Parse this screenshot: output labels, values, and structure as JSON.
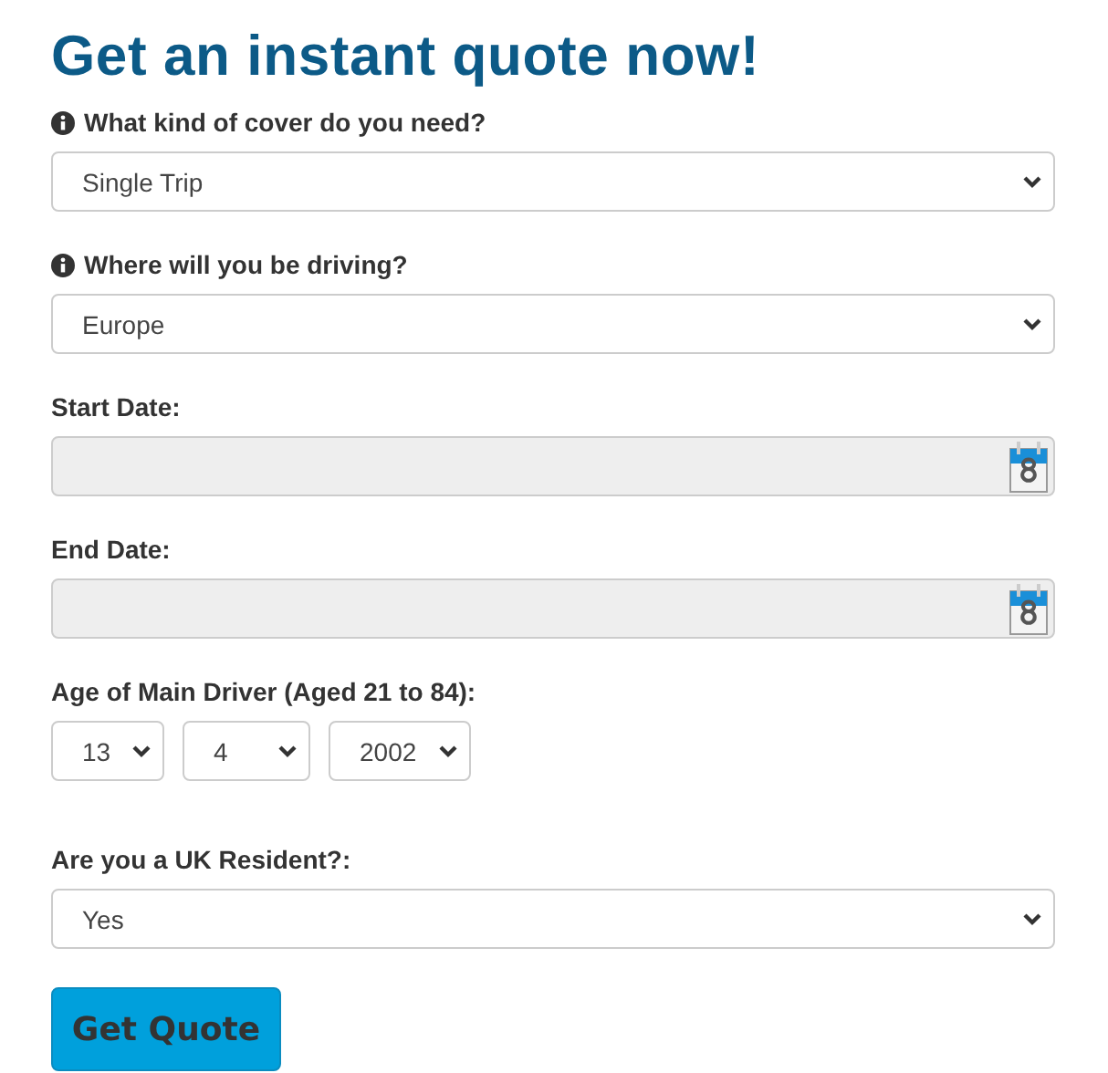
{
  "title": "Get an instant quote now!",
  "fields": [
    {
      "kind": "select",
      "label": "What kind of cover do you need?",
      "info": true,
      "value": "Single Trip"
    },
    {
      "kind": "select",
      "label": "Where will you be driving?",
      "info": true,
      "value": "Europe"
    },
    {
      "kind": "date",
      "label": "Start Date:",
      "info": false,
      "disabled": true
    },
    {
      "kind": "date",
      "label": "End Date:",
      "info": false,
      "disabled": true
    },
    {
      "kind": "dob",
      "label": "Age of Main Driver (Aged 21 to 84):",
      "info": false,
      "parts": [
        "13",
        "4",
        "2002"
      ]
    },
    {
      "kind": "select",
      "label": "Are you a UK Resident?:",
      "info": false,
      "value": "Yes"
    }
  ],
  "button": "Get Quote"
}
